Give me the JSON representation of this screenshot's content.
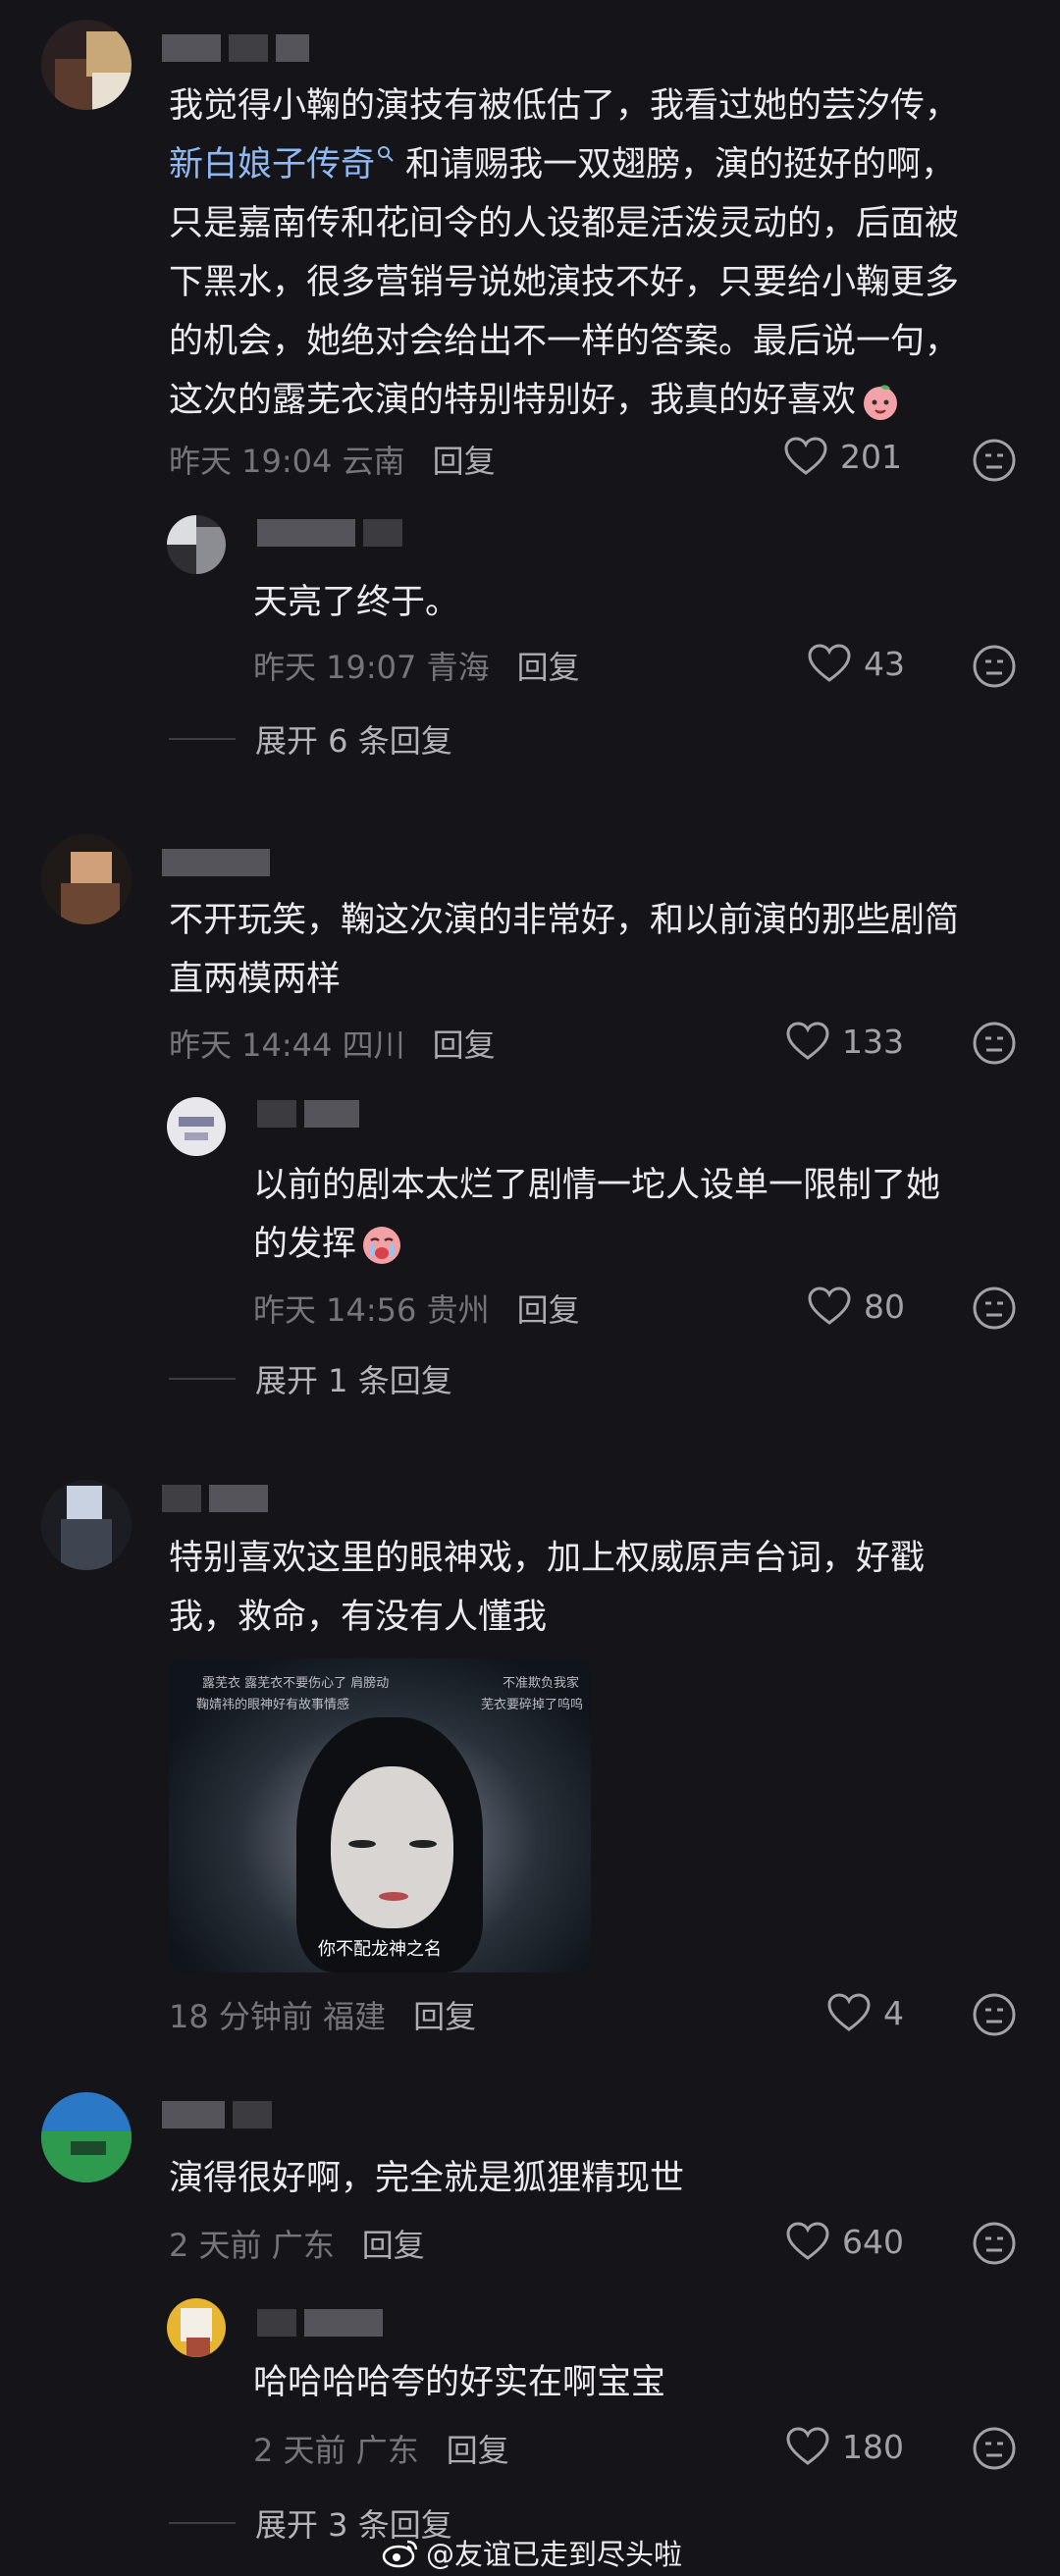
{
  "comments": [
    {
      "text": "我觉得小鞠的演技有被低估了，我看过她的芸汐传，",
      "text_link": "新白娘子传奇",
      "text_rest": " 和请赐我一双翅膀，演的挺好的啊，\n只是嘉南传和花间令的人设都是活泼灵动的，后面被\n下黑水，很多营销号说她演技不好，只要给小鞠更多\n的机会，她绝对会给出不一样的答案。最后说一句，\n这次的露芜衣演的特别特别好，我真的好喜欢",
      "meta": "昨天 19:04 云南",
      "reply_label": "回复",
      "likes": "201",
      "replies": [
        {
          "text": "天亮了终于。",
          "meta": "昨天 19:07 青海",
          "reply_label": "回复",
          "likes": "43"
        }
      ],
      "expand": "展开 6 条回复"
    },
    {
      "text": "不开玩笑，鞠这次演的非常好，和以前演的那些剧简\n直两模两样",
      "meta": "昨天 14:44 四川",
      "reply_label": "回复",
      "likes": "133",
      "replies": [
        {
          "text": "以前的剧本太烂了剧情一坨人设单一限制了她\n的发挥",
          "meta": "昨天 14:56 贵州",
          "reply_label": "回复",
          "likes": "80"
        }
      ],
      "expand": "展开 1 条回复"
    },
    {
      "text": "特别喜欢这里的眼神戏，加上权威原声台词，好戳\n我，救命，有没有人懂我",
      "meta": "18 分钟前 福建",
      "reply_label": "回复",
      "likes": "4",
      "video": {
        "danmu": [
          "露芜衣 露芜衣不要伤心了 肩膀动",
          "不准欺负我家",
          "鞠婧祎的眼神好有故事情感",
          "芜衣要碎掉了呜呜"
        ],
        "subtitle": "你不配龙神之名"
      }
    },
    {
      "text": "演得很好啊，完全就是狐狸精现世",
      "meta": "2 天前 广东",
      "reply_label": "回复",
      "likes": "640",
      "replies": [
        {
          "text": "哈哈哈哈夸的好实在啊宝宝",
          "meta": "2 天前 广东",
          "reply_label": "回复",
          "likes": "180"
        }
      ],
      "expand": "展开 3 条回复"
    }
  ],
  "watermark": "@友谊已走到尽头啦",
  "icons": {
    "like": "heart-outline-icon",
    "dislike": "frown-face-icon",
    "emoji_peach": "peach-emoji-icon",
    "emoji_crying": "crying-emoji-icon",
    "location_search": "search-link-icon",
    "weibo": "weibo-logo-icon"
  },
  "colors": {
    "background": "#151519",
    "link": "#8fb8f4",
    "meta": "#76757c"
  }
}
